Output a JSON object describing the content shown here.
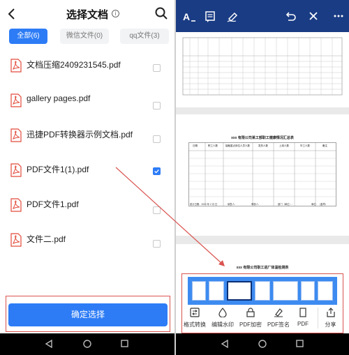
{
  "left": {
    "header": {
      "title": "选择文档",
      "info_glyph": "i"
    },
    "tabs": [
      {
        "label": "全部(6)",
        "active": true
      },
      {
        "label": "微信文件(0)",
        "active": false
      },
      {
        "label": "qq文件(3)",
        "active": false
      }
    ],
    "files": [
      {
        "name": "文档压缩2409231545.pdf",
        "checked": false
      },
      {
        "name": "gallery pages.pdf",
        "checked": false
      },
      {
        "name": "迅捷PDF转换器示例文档.pdf",
        "checked": false
      },
      {
        "name": "PDF文件1(1).pdf",
        "checked": true
      },
      {
        "name": "PDF文件1.pdf",
        "checked": false
      },
      {
        "name": "文件二.pdf",
        "checked": false
      }
    ],
    "confirm_label": "确定选择"
  },
  "right": {
    "page2_title": "xxx 有限公司某工部职工健康情况汇总表",
    "page2_cols": [
      "日期",
      "职工人数",
      "接触重点岗位人员人数",
      "发热人数",
      "上岗人数",
      "毕工人数",
      "备注"
    ],
    "page2_footer": [
      "统计日期：2020 年 2 月  日",
      "填表人：",
      "审核人：",
      "部门（单位）：",
      "单位：（盖章）"
    ],
    "page3_title": "xxx 有限公司职工进厂体温检测表",
    "tools": [
      {
        "label": "格式转换",
        "icon": "format-convert-icon"
      },
      {
        "label": "编辑水印",
        "icon": "watermark-icon"
      },
      {
        "label": "PDF加密",
        "icon": "lock-icon"
      },
      {
        "label": "PDF签名",
        "icon": "signature-icon"
      },
      {
        "label": "PDF",
        "icon": "more-pdf-icon"
      },
      {
        "label": "分享",
        "icon": "share-icon"
      }
    ]
  },
  "colors": {
    "accent": "#2d7cf6",
    "toolbar": "#1a3c84",
    "highlight_border": "#d9534f",
    "pdf_red": "#e24a3b"
  }
}
